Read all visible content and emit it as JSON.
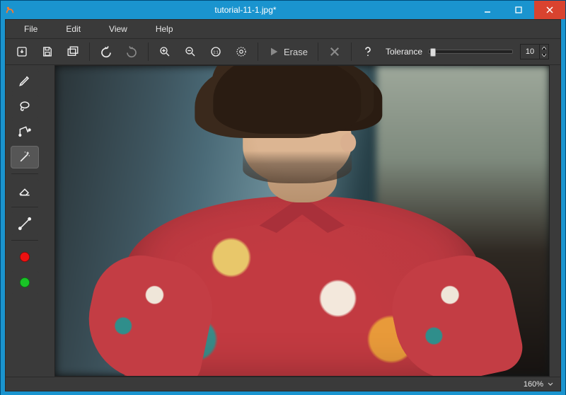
{
  "window": {
    "title": "tutorial-11-1.jpg*"
  },
  "menubar": {
    "items": [
      {
        "label": "File"
      },
      {
        "label": "Edit"
      },
      {
        "label": "View"
      },
      {
        "label": "Help"
      }
    ]
  },
  "toolbar": {
    "save_name": "save-button",
    "open_name": "open-button",
    "browse_name": "browse-button",
    "undo_name": "undo-button",
    "redo_name": "redo-button",
    "zoom_in_name": "zoom-in-button",
    "zoom_out_name": "zoom-out-button",
    "zoom_1to1_name": "zoom-1to1-button",
    "zoom_fit_name": "zoom-fit-button",
    "erase_label": "Erase",
    "cancel_name": "cancel-button",
    "help_name": "help-button",
    "tolerance_label": "Tolerance",
    "tolerance_value": "10"
  },
  "side_tools": {
    "pen": "pen-tool",
    "lasso": "lasso-tool",
    "polygon": "polygon-tool",
    "magic_wand": "magic-wand-tool",
    "eraser": "eraser-tool",
    "line": "line-tool",
    "red_marker": "red-marker-tool",
    "green_marker": "green-marker-tool",
    "selected": "magic-wand-tool"
  },
  "status": {
    "zoom": "160%"
  },
  "colors": {
    "frame": "#1a94cf",
    "app_bg": "#3a3a3a",
    "close": "#d9432f",
    "red_marker": "#e11111",
    "green_marker": "#19c326"
  }
}
